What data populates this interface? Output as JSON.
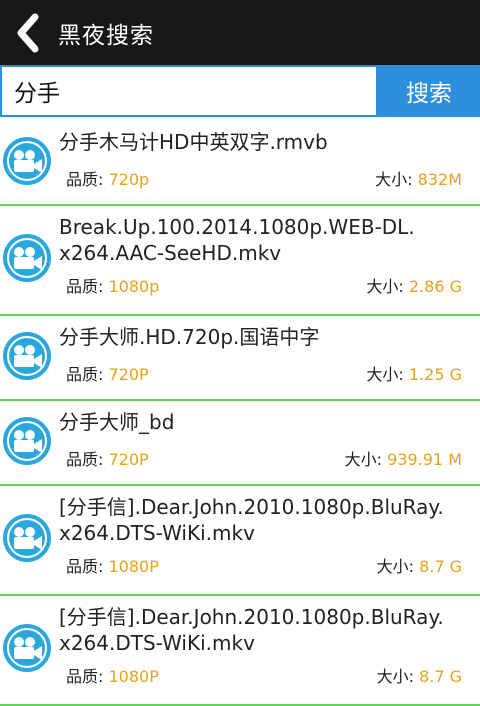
{
  "header": {
    "title": "黑夜搜索"
  },
  "search": {
    "query": "分手",
    "button_label": "搜索"
  },
  "labels": {
    "quality": "品质:",
    "size": "大小:"
  },
  "results": [
    {
      "name_lines": [
        "分手木马计HD中英双字.rmvb"
      ],
      "quality": "720p",
      "size": "832M"
    },
    {
      "name_lines": [
        "Break.Up.100.2014.1080p.WEB-DL.",
        "x264.AAC-SeeHD.mkv"
      ],
      "quality": "1080p",
      "size": "2.86 G"
    },
    {
      "name_lines": [
        "分手大师.HD.720p.国语中字"
      ],
      "quality": "720P",
      "size": "1.25 G"
    },
    {
      "name_lines": [
        "分手大师_bd"
      ],
      "quality": "720P",
      "size": "939.91 M"
    },
    {
      "name_lines": [
        "[分手信].Dear.John.2010.1080p.BluRay.",
        "x264.DTS-WiKi.mkv"
      ],
      "quality": "1080P",
      "size": "8.7 G"
    },
    {
      "name_lines": [
        "[分手信].Dear.John.2010.1080p.BluRay.",
        "x264.DTS-WiKi.mkv"
      ],
      "quality": "1080P",
      "size": "8.7 G"
    }
  ],
  "colors": {
    "accent": "#2d8fdc",
    "value": "#e8a21a",
    "divider": "#5fd35a",
    "titlebar": "#181818"
  },
  "icons": {
    "back": "chevron-left-icon",
    "item": "video-camera-icon"
  }
}
